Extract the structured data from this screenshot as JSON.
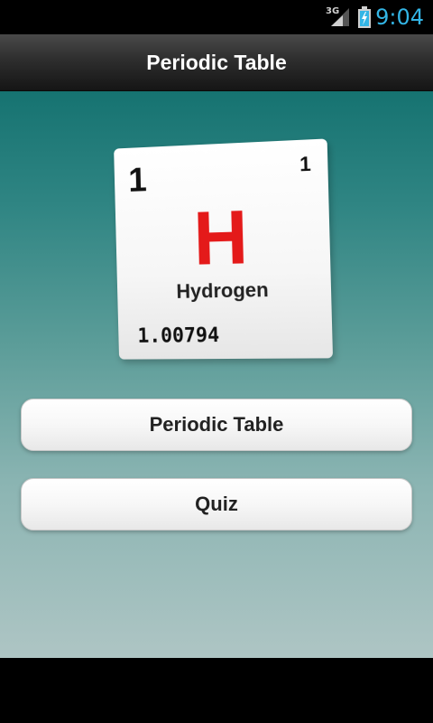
{
  "status_bar": {
    "network": "3G",
    "time": "9:04",
    "accent_color": "#33b5e5"
  },
  "app_bar": {
    "title": "Periodic Table"
  },
  "element_card": {
    "atomic_number": "1",
    "corner_number": "1",
    "symbol": "H",
    "name": "Hydrogen",
    "atomic_mass": "1.00794",
    "symbol_color": "#e41a1a"
  },
  "menu": {
    "buttons": [
      {
        "label": "Periodic Table"
      },
      {
        "label": "Quiz"
      }
    ]
  }
}
